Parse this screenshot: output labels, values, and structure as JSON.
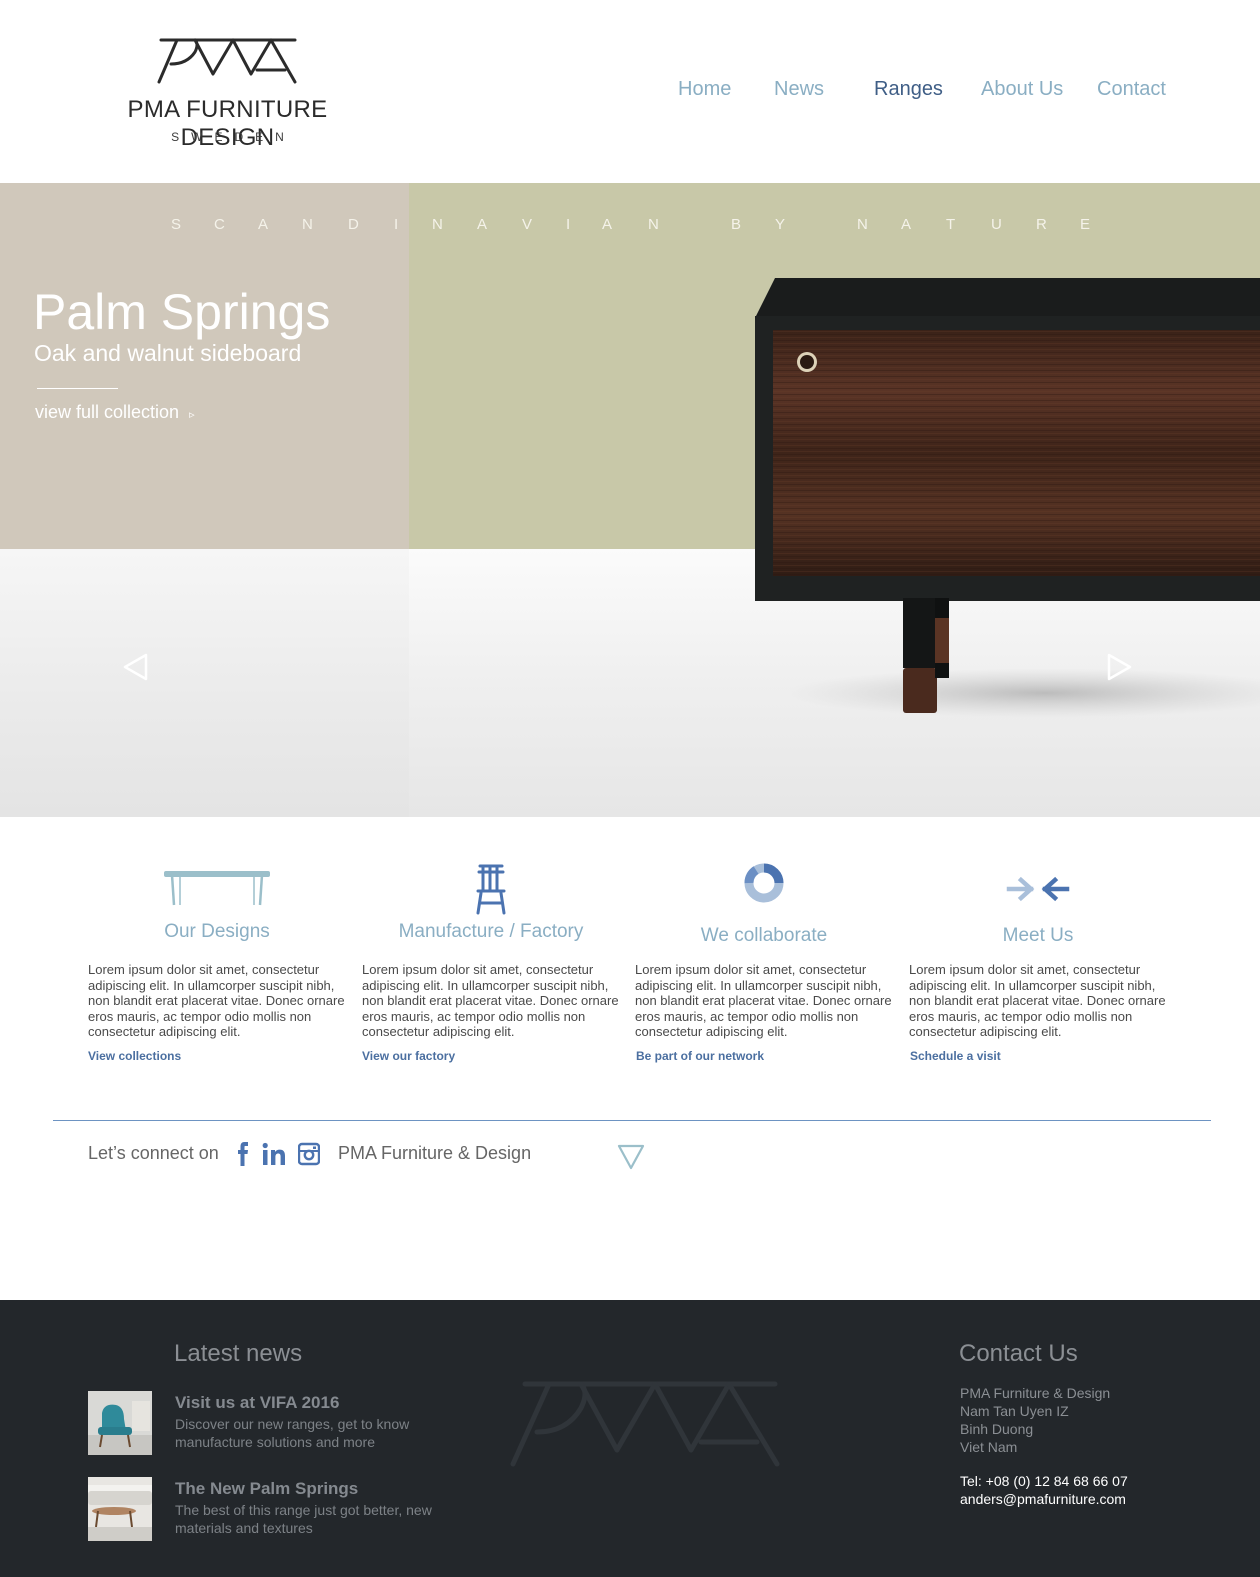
{
  "brand": {
    "name": "PMA FURNITURE DESIGN",
    "subtitle": "SWEDEN"
  },
  "nav": {
    "items": [
      {
        "label": "Home"
      },
      {
        "label": "News"
      },
      {
        "label": "Ranges"
      },
      {
        "label": "About Us"
      },
      {
        "label": "Contact"
      }
    ],
    "active": "Ranges"
  },
  "hero": {
    "tagline_letters": [
      "S",
      "C",
      "A",
      "N",
      "D",
      "I",
      "N",
      "A",
      "V",
      "I",
      "A",
      "N",
      "B",
      "Y",
      "N",
      "A",
      "T",
      "U",
      "R",
      "E"
    ],
    "title": "Palm Springs",
    "subtitle": "Oak and walnut sideboard",
    "link": "view full collection",
    "link_arrow": "▹",
    "colors": {
      "left_panel": "#d0c8bb",
      "right_panel": "#c8c8a8"
    }
  },
  "features": [
    {
      "icon": "table-icon",
      "title": "Our Designs",
      "text": "Lorem ipsum dolor sit amet, consectetur adipiscing elit. In ullamcorper suscipit nibh, non blandit erat placerat vitae. Donec ornare eros mauris, ac tempor odio mollis non consectetur adipiscing elit.",
      "link": "View collections"
    },
    {
      "icon": "chair-icon",
      "title": "Manufacture / Factory",
      "text": "Lorem ipsum dolor sit amet, consectetur adipiscing elit. In ullamcorper suscipit nibh, non blandit erat placerat vitae. Donec ornare eros mauris, ac tempor odio mollis non consectetur adipiscing elit.",
      "link": "View our factory"
    },
    {
      "icon": "ring-icon",
      "title": "We collaborate",
      "text": "Lorem ipsum dolor sit amet, consectetur adipiscing elit. In ullamcorper suscipit nibh, non blandit erat placerat vitae. Donec ornare eros mauris, ac tempor odio mollis non consectetur adipiscing elit.",
      "link": "Be part of our network"
    },
    {
      "icon": "arrows-meet-icon",
      "title": "Meet Us",
      "text": "Lorem ipsum dolor sit amet, consectetur adipiscing elit. In ullamcorper suscipit nibh, non blandit erat placerat vitae. Donec ornare eros mauris, ac tempor odio mollis non consectetur adipiscing elit.",
      "link": "Schedule a visit"
    }
  ],
  "connect": {
    "label": "Let’s connect on",
    "company": "PMA Furniture & Design",
    "social": [
      "facebook-icon",
      "linkedin-icon",
      "instagram-icon"
    ]
  },
  "footer": {
    "news_title": "Latest news",
    "news": [
      {
        "title": "Visit us at VIFA 2016",
        "desc": "Discover our new ranges, get to know manufacture solutions and more"
      },
      {
        "title": "The New Palm Springs",
        "desc": "The best of this range just got better, new materials and textures"
      }
    ],
    "contact_title": "Contact Us",
    "address": [
      "PMA Furniture & Design",
      "Nam Tan Uyen IZ",
      "Binh Duong",
      "Viet Nam"
    ],
    "tel": "Tel: +08 (0) 12 84 68 66 07",
    "email": "anders@pmafurniture.com"
  },
  "colors": {
    "nav": "#8aaec3",
    "nav_active": "#3f5e86",
    "accent": "#4b6fa0",
    "footer_bg": "#23272b"
  }
}
